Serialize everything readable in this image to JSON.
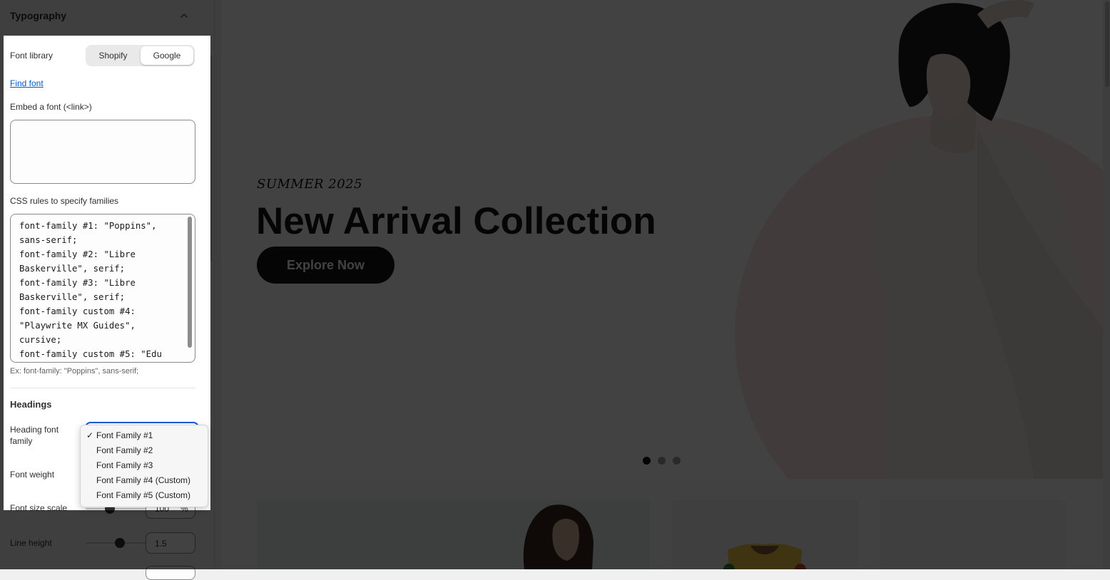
{
  "panel": {
    "title": "Typography",
    "font_library_label": "Font library",
    "font_library_options": [
      "Shopify",
      "Google"
    ],
    "font_library_selected": "Google",
    "find_font_link": "Find font",
    "embed_label": "Embed a font (<link>)",
    "embed_value": "",
    "css_rules_label": "CSS rules to specify families",
    "css_rules_value": "font-family #1: \"Poppins\",\nsans-serif;\nfont-family #2: \"Libre\nBaskerville\", serif;\nfont-family #3: \"Libre\nBaskerville\", serif;\nfont-family custom #4:\n\"Playwrite MX Guides\",\ncursive;\nfont-family custom #5: \"Edu",
    "css_rules_hint": "Ex: font-family: \"Poppins\", sans-serif;",
    "headings_title": "Headings",
    "heading_font_family_label": "Heading font\nfamily",
    "font_weight_label": "Font weight",
    "font_size_scale_label": "Font size scale",
    "font_size_scale_value": "100",
    "font_size_scale_unit": "%",
    "line_height_label": "Line height",
    "line_height_value": "1.5"
  },
  "dropdown": {
    "options": [
      "Font Family #1",
      "Font Family #2",
      "Font Family #3",
      "Font Family #4 (Custom)",
      "Font Family #5 (Custom)"
    ],
    "selected_index": 0,
    "check_glyph": "✓"
  },
  "preview": {
    "eyebrow": "SUMMER 2025",
    "title": "New Arrival Collection",
    "button": "Explore Now",
    "slide_count": 3,
    "active_slide": 1
  },
  "colors": {
    "accent": "#005bd3",
    "hero_button": "#161616",
    "pink_circle": "#fbe6e4"
  }
}
